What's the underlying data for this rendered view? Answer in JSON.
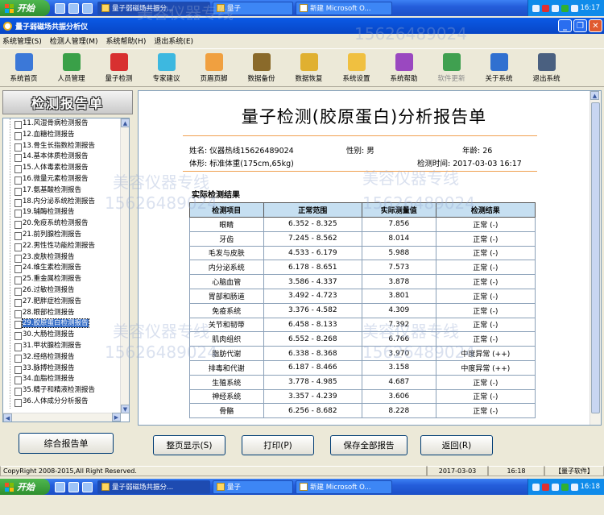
{
  "taskbar": {
    "start": "开始",
    "tasks": [
      "量子弱磁场共振分...",
      "量子",
      "新建 Microsoft O..."
    ],
    "clock": "16:17",
    "bottom_clock": "16:18"
  },
  "window": {
    "title": "量子弱磁场共振分析仪",
    "menu": [
      "系统管理(S)",
      "检测人管理(M)",
      "系统帮助(H)",
      "退出系统(E)"
    ]
  },
  "toolbar": [
    {
      "label": "系统首页",
      "icon": "home-icon",
      "color": "#3b78d8"
    },
    {
      "label": "人员管理",
      "icon": "people-icon",
      "color": "#3aa048"
    },
    {
      "label": "量子检测",
      "icon": "network-icon",
      "color": "#d83030"
    },
    {
      "label": "专家建议",
      "icon": "book-icon",
      "color": "#3db8e0"
    },
    {
      "label": "页眉页脚",
      "icon": "document-icon",
      "color": "#f0a040"
    },
    {
      "label": "数据备份",
      "icon": "archive-icon",
      "color": "#8a6a2a"
    },
    {
      "label": "数据恢复",
      "icon": "restore-icon",
      "color": "#e0b030"
    },
    {
      "label": "系统设置",
      "icon": "folder-icon",
      "color": "#f0c040"
    },
    {
      "label": "系统帮助",
      "icon": "help-icon",
      "color": "#9a48c0"
    },
    {
      "label": "软件更新",
      "icon": "update-icon",
      "color": "#40a050"
    },
    {
      "label": "关于系统",
      "icon": "chart-icon",
      "color": "#3070d0"
    },
    {
      "label": "退出系统",
      "icon": "exit-icon",
      "color": "#4a6080"
    }
  ],
  "left": {
    "header": "检测报告单",
    "items": [
      "11.风湿骨病检测报告",
      "12.血糖检测报告",
      "13.骨生长指数检测报告",
      "14.基本体质检测报告",
      "15.人体毒素检测报告",
      "16.微量元素检测报告",
      "17.氨基酸检测报告",
      "18.内分泌系统检测报告",
      "19.辅酶检测报告",
      "20.免疫系统检测报告",
      "21.前列腺检测报告",
      "22.男性性功能检测报告",
      "23.皮肤检测报告",
      "24.维生素检测报告",
      "25.重金属检测报告",
      "26.过敏检测报告",
      "27.肥胖症检测报告",
      "28.眼部检测报告",
      "29.胶原蛋白检测报告",
      "30.大肠检测报告",
      "31.甲状腺检测报告",
      "32.经络检测报告",
      "33.脉搏检测报告",
      "34.血脂检测报告",
      "35.精子和精液检测报告",
      "36.人体成分分析报告"
    ],
    "selected_index": 18,
    "button": "综合报告单"
  },
  "report": {
    "title": "量子检测(胶原蛋白)分析报告单",
    "name": "姓名: 仪器热线15626489024",
    "gender": "性别: 男",
    "age": "年龄: 26",
    "body": "体形: 标准体重(175cm,65kg)",
    "time": "检测时间: 2017-03-03 16:17",
    "section": "实际检测结果",
    "headers": [
      "检测项目",
      "正常范围",
      "实际测量值",
      "检测结果"
    ],
    "rows": [
      [
        "眼睛",
        "6.352 - 8.325",
        "7.856",
        "正常 (-)"
      ],
      [
        "牙齿",
        "7.245 - 8.562",
        "8.014",
        "正常 (-)"
      ],
      [
        "毛发与皮肤",
        "4.533 - 6.179",
        "5.988",
        "正常 (-)"
      ],
      [
        "内分泌系统",
        "6.178 - 8.651",
        "7.573",
        "正常 (-)"
      ],
      [
        "心脑血管",
        "3.586 - 4.337",
        "3.878",
        "正常 (-)"
      ],
      [
        "胃部和肠道",
        "3.492 - 4.723",
        "3.801",
        "正常 (-)"
      ],
      [
        "免疫系统",
        "3.376 - 4.582",
        "4.309",
        "正常 (-)"
      ],
      [
        "关节和韧带",
        "6.458 - 8.133",
        "7.392",
        "正常 (-)"
      ],
      [
        "肌肉组织",
        "6.552 - 8.268",
        "6.766",
        "正常 (-)"
      ],
      [
        "脂肪代谢",
        "6.338 - 8.368",
        "3.970",
        "中度异常 (++)"
      ],
      [
        "排毒和代谢",
        "6.187 - 8.466",
        "3.158",
        "中度异常 (++)"
      ],
      [
        "生殖系统",
        "3.778 - 4.985",
        "4.687",
        "正常 (-)"
      ],
      [
        "神经系统",
        "3.357 - 4.239",
        "3.606",
        "正常 (-)"
      ],
      [
        "骨骼",
        "6.256 - 8.682",
        "8.228",
        "正常 (-)"
      ]
    ]
  },
  "buttons": [
    "整页显示(S)",
    "打印(P)",
    "保存全部报告",
    "返回(R)"
  ],
  "status": {
    "copyright": "CopyRight 2008-2015,All Right Reserved.",
    "date": "2017-03-03",
    "time": "16:18",
    "software": "【量子软件】"
  },
  "watermarks": [
    "美容仪器专线",
    "15626489024"
  ]
}
